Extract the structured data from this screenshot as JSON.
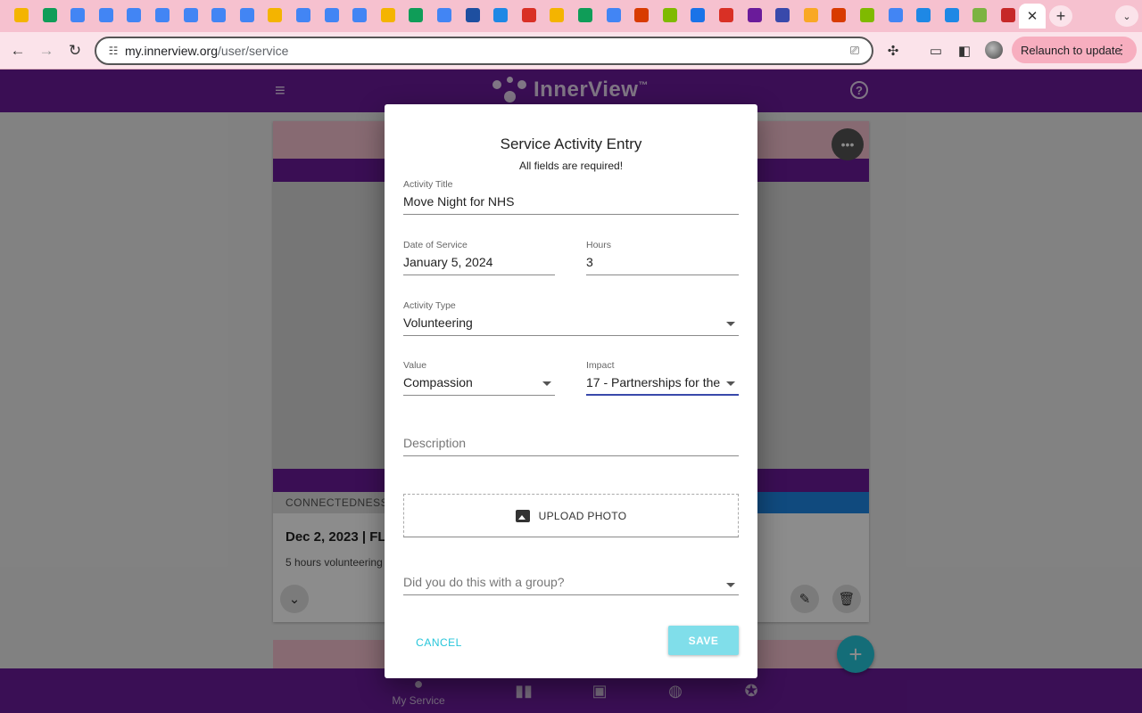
{
  "browser": {
    "tab_favicons": [
      {
        "name": "drive-icon",
        "color": "#f4b400"
      },
      {
        "name": "drive-icon",
        "color": "#0f9d58"
      },
      {
        "name": "docs-icon",
        "color": "#4285f4"
      },
      {
        "name": "docs-icon",
        "color": "#4285f4"
      },
      {
        "name": "docs-icon",
        "color": "#4285f4"
      },
      {
        "name": "docs-icon",
        "color": "#4285f4"
      },
      {
        "name": "docs-icon",
        "color": "#4285f4"
      },
      {
        "name": "docs-icon",
        "color": "#4285f4"
      },
      {
        "name": "docs-icon",
        "color": "#4285f4"
      },
      {
        "name": "slides-icon",
        "color": "#f4b400"
      },
      {
        "name": "docs-icon",
        "color": "#4285f4"
      },
      {
        "name": "docs-icon",
        "color": "#4285f4"
      },
      {
        "name": "docs-icon",
        "color": "#4285f4"
      },
      {
        "name": "slides-icon",
        "color": "#f4b400"
      },
      {
        "name": "drive-icon",
        "color": "#0f9d58"
      },
      {
        "name": "docs-icon",
        "color": "#4285f4"
      },
      {
        "name": "app-icon",
        "color": "#1e4fa0"
      },
      {
        "name": "app-icon",
        "color": "#1e88e5"
      },
      {
        "name": "gmail-icon",
        "color": "#d93025"
      },
      {
        "name": "slides-icon",
        "color": "#f4b400"
      },
      {
        "name": "drive-icon",
        "color": "#0f9d58"
      },
      {
        "name": "docs-icon",
        "color": "#4285f4"
      },
      {
        "name": "office-icon",
        "color": "#d83b01"
      },
      {
        "name": "microsoft-icon",
        "color": "#7fba00"
      },
      {
        "name": "app-icon",
        "color": "#1a73e8"
      },
      {
        "name": "gmail-icon",
        "color": "#d93025"
      },
      {
        "name": "app-icon",
        "color": "#6a1b9a"
      },
      {
        "name": "app-icon",
        "color": "#3949ab"
      },
      {
        "name": "app-icon",
        "color": "#f9a825"
      },
      {
        "name": "office-icon",
        "color": "#d83b01"
      },
      {
        "name": "microsoft-icon",
        "color": "#7fba00"
      },
      {
        "name": "google-icon",
        "color": "#4285f4"
      },
      {
        "name": "app-icon",
        "color": "#1e88e5"
      },
      {
        "name": "app-icon",
        "color": "#1e88e5"
      },
      {
        "name": "app-icon",
        "color": "#7cb342"
      },
      {
        "name": "app-icon",
        "color": "#c62828"
      }
    ],
    "active_tab_close": "✕",
    "new_tab": "+",
    "tab_menu": "⌄",
    "url_host": "my.innerview.org",
    "url_path": "/user/service",
    "relaunch_label": "Relaunch to update",
    "relaunch_menu": "⋮"
  },
  "app": {
    "logo_text": "InnerView",
    "logo_tm": "™",
    "help": "?",
    "bottom_nav": {
      "my_service": "My Service"
    }
  },
  "card": {
    "tag": "CONNECTEDNESS",
    "date_line": "Dec 2, 2023 | FLL",
    "desc": "5 hours volunteering"
  },
  "dialog": {
    "title": "Service Activity Entry",
    "subtitle": "All fields are required!",
    "activity_title": {
      "label": "Activity Title",
      "value": "Move Night for NHS"
    },
    "date_of_service": {
      "label": "Date of Service",
      "value": "January 5, 2024"
    },
    "hours": {
      "label": "Hours",
      "value": "3"
    },
    "activity_type": {
      "label": "Activity Type",
      "value": "Volunteering"
    },
    "value_field": {
      "label": "Value",
      "value": "Compassion"
    },
    "impact": {
      "label": "Impact",
      "value": "17 - Partnerships for the"
    },
    "description": {
      "placeholder": "Description"
    },
    "upload_photo": "UPLOAD PHOTO",
    "group": {
      "placeholder": "Did you do this with a group?"
    },
    "cancel": "CANCEL",
    "save": "SAVE"
  }
}
